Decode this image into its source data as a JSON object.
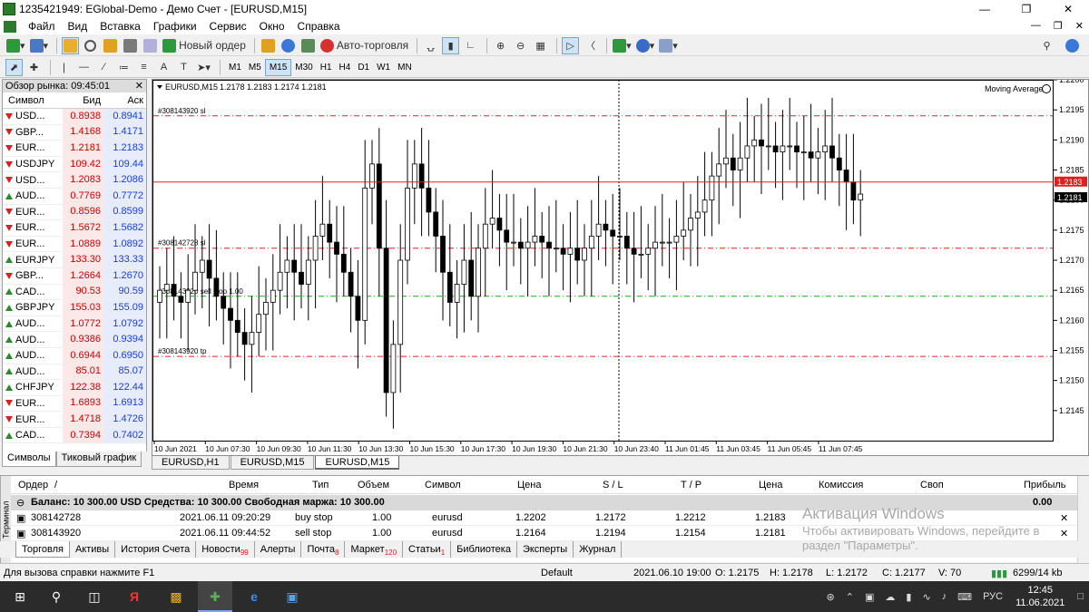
{
  "window": {
    "title": "1235421949: EGlobal-Demo - Демо Счет - [EURUSD,M15]"
  },
  "menu": [
    "Файл",
    "Вид",
    "Вставка",
    "Графики",
    "Сервис",
    "Окно",
    "Справка"
  ],
  "toolbar": {
    "new_order": "Новый ордер",
    "auto_trading": "Авто-торговля"
  },
  "timeframes": [
    "M1",
    "M5",
    "M15",
    "M30",
    "H1",
    "H4",
    "D1",
    "W1",
    "MN"
  ],
  "timeframe_selected": "M15",
  "market_watch": {
    "title": "Обзор рынка: 09:45:01",
    "columns": {
      "symbol": "Символ",
      "bid": "Бид",
      "ask": "Аск"
    },
    "rows": [
      {
        "s": "USD...",
        "b": "0.8938",
        "a": "0.8941",
        "d": "dn"
      },
      {
        "s": "GBP...",
        "b": "1.4168",
        "a": "1.4171",
        "d": "dn"
      },
      {
        "s": "EUR...",
        "b": "1.2181",
        "a": "1.2183",
        "d": "dn"
      },
      {
        "s": "USDJPY",
        "b": "109.42",
        "a": "109.44",
        "d": "dn"
      },
      {
        "s": "USD...",
        "b": "1.2083",
        "a": "1.2086",
        "d": "dn"
      },
      {
        "s": "AUD...",
        "b": "0.7769",
        "a": "0.7772",
        "d": "up"
      },
      {
        "s": "EUR...",
        "b": "0.8596",
        "a": "0.8599",
        "d": "dn"
      },
      {
        "s": "EUR...",
        "b": "1.5672",
        "a": "1.5682",
        "d": "dn"
      },
      {
        "s": "EUR...",
        "b": "1.0889",
        "a": "1.0892",
        "d": "dn"
      },
      {
        "s": "EURJPY",
        "b": "133.30",
        "a": "133.33",
        "d": "up"
      },
      {
        "s": "GBP...",
        "b": "1.2664",
        "a": "1.2670",
        "d": "dn"
      },
      {
        "s": "CAD...",
        "b": "90.53",
        "a": "90.59",
        "d": "up"
      },
      {
        "s": "GBPJPY",
        "b": "155.03",
        "a": "155.09",
        "d": "up"
      },
      {
        "s": "AUD...",
        "b": "1.0772",
        "a": "1.0792",
        "d": "up"
      },
      {
        "s": "AUD...",
        "b": "0.9386",
        "a": "0.9394",
        "d": "up"
      },
      {
        "s": "AUD...",
        "b": "0.6944",
        "a": "0.6950",
        "d": "up"
      },
      {
        "s": "AUD...",
        "b": "85.01",
        "a": "85.07",
        "d": "up"
      },
      {
        "s": "CHFJPY",
        "b": "122.38",
        "a": "122.44",
        "d": "up"
      },
      {
        "s": "EUR...",
        "b": "1.6893",
        "a": "1.6913",
        "d": "dn"
      },
      {
        "s": "EUR...",
        "b": "1.4718",
        "a": "1.4726",
        "d": "dn"
      },
      {
        "s": "CAD...",
        "b": "0.7394",
        "a": "0.7402",
        "d": "up"
      }
    ],
    "tabs": [
      "Символы",
      "Тиковый график"
    ]
  },
  "chart_data": {
    "type": "candlestick",
    "title": "EURUSD,M15",
    "ohlc_label": "1.2178 1.2183 1.2174 1.2181",
    "indicator": "Moving Average",
    "ylim": [
      1.214,
      1.22
    ],
    "yticks": [
      1.2145,
      1.215,
      1.2155,
      1.216,
      1.2165,
      1.217,
      1.2175,
      1.218,
      1.2185,
      1.219,
      1.2195,
      1.22
    ],
    "ytick_labels": [
      "1.2145",
      "1.2150",
      "1.2155",
      "1.2160",
      "1.2165",
      "1.2170",
      "1.2175",
      "1.2180",
      "1.2185",
      "1.2190",
      "1.2195",
      "1.2200"
    ],
    "xtick_labels": [
      "10 Jun 2021",
      "10 Jun 07:30",
      "10 Jun 09:30",
      "10 Jun 11:30",
      "10 Jun 13:30",
      "10 Jun 15:30",
      "10 Jun 17:30",
      "10 Jun 19:30",
      "10 Jun 21:30",
      "10 Jun 23:40",
      "11 Jun 01:45",
      "11 Jun 03:45",
      "11 Jun 05:45",
      "11 Jun 07:45"
    ],
    "bid_price": 1.2183,
    "bid_label": "1.2183",
    "ask_price": 1.2181,
    "ask_label": "1.2181",
    "levels": [
      {
        "label": "#308143920 sl",
        "price": 1.2194,
        "color": "#e02020"
      },
      {
        "label": "#308142728 sl",
        "price": 1.2172,
        "color": "#e02020"
      },
      {
        "label": "#308143920 sell stop 1.00",
        "price": 1.2164,
        "color": "#10b010"
      },
      {
        "label": "#308143920 tp",
        "price": 1.2154,
        "color": "#e02020"
      }
    ],
    "close_series": [
      1.2165,
      1.2166,
      1.2164,
      1.2163,
      1.2165,
      1.2168,
      1.217,
      1.2167,
      1.2164,
      1.2162,
      1.216,
      1.2158,
      1.2156,
      1.2158,
      1.2161,
      1.2163,
      1.2165,
      1.2168,
      1.217,
      1.2168,
      1.2166,
      1.217,
      1.2174,
      1.2176,
      1.2173,
      1.2171,
      1.2168,
      1.2164,
      1.216,
      1.2182,
      1.2186,
      1.2172,
      1.2148,
      1.2156,
      1.217,
      1.2182,
      1.2186,
      1.2182,
      1.2178,
      1.2174,
      1.2168,
      1.2163,
      1.2166,
      1.217,
      1.2164,
      1.2172,
      1.2176,
      1.2177,
      1.2175,
      1.2173,
      1.2173,
      1.2172,
      1.2173,
      1.2174,
      1.2173,
      1.2172,
      1.2172,
      1.2171,
      1.2172,
      1.217,
      1.2172,
      1.2174,
      1.2176,
      1.2175,
      1.2174,
      1.2174,
      1.2172,
      1.2171,
      1.2171,
      1.2172,
      1.2173,
      1.2173,
      1.2173,
      1.2174,
      1.2175,
      1.2177,
      1.2178,
      1.218,
      1.2184,
      1.2186,
      1.2187,
      1.2185,
      1.2187,
      1.2189,
      1.219,
      1.2189,
      1.2189,
      1.2188,
      1.2189,
      1.2189,
      1.2188,
      1.2188,
      1.2187,
      1.2188,
      1.2189,
      1.2187,
      1.2185,
      1.2183,
      1.218,
      1.2181
    ]
  },
  "chart_tabs": [
    "EURUSD,H1",
    "EURUSD,M15",
    "EURUSD,M15"
  ],
  "chart_tab_active": 2,
  "terminal": {
    "side_label": "Терминал",
    "columns": [
      "Ордер",
      "Время",
      "Тип",
      "Объем",
      "Символ",
      "Цена",
      "S / L",
      "T / P",
      "Цена",
      "Комиссия",
      "Своп",
      "Прибыль"
    ],
    "balance_text": "Баланс: 10 300.00 USD  Средства: 10 300.00  Свободная маржа: 10 300.00",
    "balance_profit": "0.00",
    "orders": [
      {
        "id": "308142728",
        "time": "2021.06.11 09:20:29",
        "type": "buy stop",
        "volume": "1.00",
        "symbol": "eurusd",
        "price": "1.2202",
        "sl": "1.2172",
        "tp": "1.2212",
        "cur": "1.2183"
      },
      {
        "id": "308143920",
        "time": "2021.06.11 09:44:52",
        "type": "sell stop",
        "volume": "1.00",
        "symbol": "eurusd",
        "price": "1.2164",
        "sl": "1.2194",
        "tp": "1.2154",
        "cur": "1.2181"
      }
    ],
    "tabs": [
      {
        "label": "Торговля",
        "badge": ""
      },
      {
        "label": "Активы",
        "badge": ""
      },
      {
        "label": "История Счета",
        "badge": ""
      },
      {
        "label": "Новости",
        "badge": "99"
      },
      {
        "label": "Алерты",
        "badge": ""
      },
      {
        "label": "Почта",
        "badge": "8"
      },
      {
        "label": "Маркет",
        "badge": "120"
      },
      {
        "label": "Статьи",
        "badge": "1"
      },
      {
        "label": "Библиотека",
        "badge": ""
      },
      {
        "label": "Эксперты",
        "badge": ""
      },
      {
        "label": "Журнал",
        "badge": ""
      }
    ]
  },
  "watermark": {
    "line1": "Активация Windows",
    "line2": "Чтобы активировать Windows, перейдите в",
    "line3": "раздел \"Параметры\"."
  },
  "status": {
    "help": "Для вызова справки нажмите F1",
    "profile": "Default",
    "datetime": "2021.06.10 19:00",
    "open": "O: 1.2175",
    "high": "H: 1.2178",
    "low": "L: 1.2172",
    "close": "C: 1.2177",
    "volume": "V: 70",
    "traffic": "6299/14 kb"
  },
  "taskbar": {
    "lang": "РУС",
    "time": "12:45",
    "date": "11.06.2021"
  }
}
